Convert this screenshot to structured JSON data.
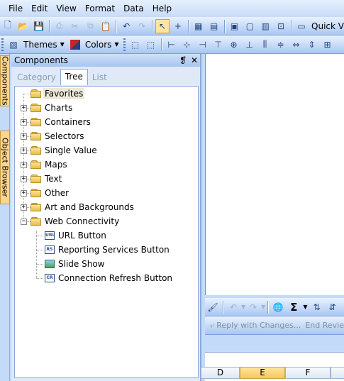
{
  "menu": [
    "File",
    "Edit",
    "View",
    "Format",
    "Data",
    "Help"
  ],
  "toolbar1": {
    "quick_label": "Quick V"
  },
  "toolbar2": {
    "themes_label": "Themes",
    "colors_label": "Colors"
  },
  "side_tabs": {
    "components": "Components",
    "object_browser": "Object Browser"
  },
  "panel": {
    "title": "Components",
    "pin": "❡",
    "close": "✕",
    "tabs": [
      "Category",
      "Tree",
      "List"
    ],
    "selected_tab": "Tree"
  },
  "tree": {
    "folders": [
      "Favorites",
      "Charts",
      "Containers",
      "Selectors",
      "Single Value",
      "Maps",
      "Text",
      "Other",
      "Art and Backgrounds",
      "Web Connectivity"
    ],
    "children": [
      {
        "label": "URL Button",
        "icon": "URL"
      },
      {
        "label": "Reporting Services Button",
        "icon": "RS"
      },
      {
        "label": "Slide Show",
        "icon": ""
      },
      {
        "label": "Connection Refresh Button",
        "icon": "CR"
      }
    ]
  },
  "lower_toolbar": {
    "sigma": "Σ",
    "reply_label": "Reply with Changes...",
    "end_review_label": "End Review"
  },
  "sheet": {
    "columns": [
      "D",
      "E",
      "F"
    ],
    "active_column": "E"
  }
}
